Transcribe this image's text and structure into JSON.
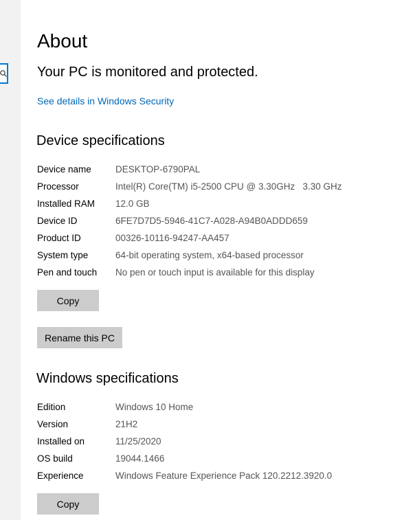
{
  "page": {
    "title": "About",
    "protection_message": "Your PC is monitored and protected.",
    "security_link": "See details in Windows Security"
  },
  "device_specs": {
    "title": "Device specifications",
    "rows": [
      {
        "label": "Device name",
        "value": "DESKTOP-6790PAL"
      },
      {
        "label": "Processor",
        "value": "Intel(R) Core(TM) i5-2500 CPU @ 3.30GHz   3.30 GHz"
      },
      {
        "label": "Installed RAM",
        "value": "12.0 GB"
      },
      {
        "label": "Device ID",
        "value": "6FE7D7D5-5946-41C7-A028-A94B0ADDD659"
      },
      {
        "label": "Product ID",
        "value": "00326-10116-94247-AA457"
      },
      {
        "label": "System type",
        "value": "64-bit operating system, x64-based processor"
      },
      {
        "label": "Pen and touch",
        "value": "No pen or touch input is available for this display"
      }
    ],
    "copy_label": "Copy",
    "rename_label": "Rename this PC"
  },
  "windows_specs": {
    "title": "Windows specifications",
    "rows": [
      {
        "label": "Edition",
        "value": "Windows 10 Home"
      },
      {
        "label": "Version",
        "value": "21H2"
      },
      {
        "label": "Installed on",
        "value": "11/25/2020"
      },
      {
        "label": "OS build",
        "value": "19044.1466"
      },
      {
        "label": "Experience",
        "value": "Windows Feature Experience Pack 120.2212.3920.0"
      }
    ],
    "copy_label": "Copy"
  },
  "colors": {
    "link": "#0067b8",
    "button": "#cccccc",
    "accent": "#0078d7"
  },
  "icons": {
    "search": "search-icon"
  }
}
